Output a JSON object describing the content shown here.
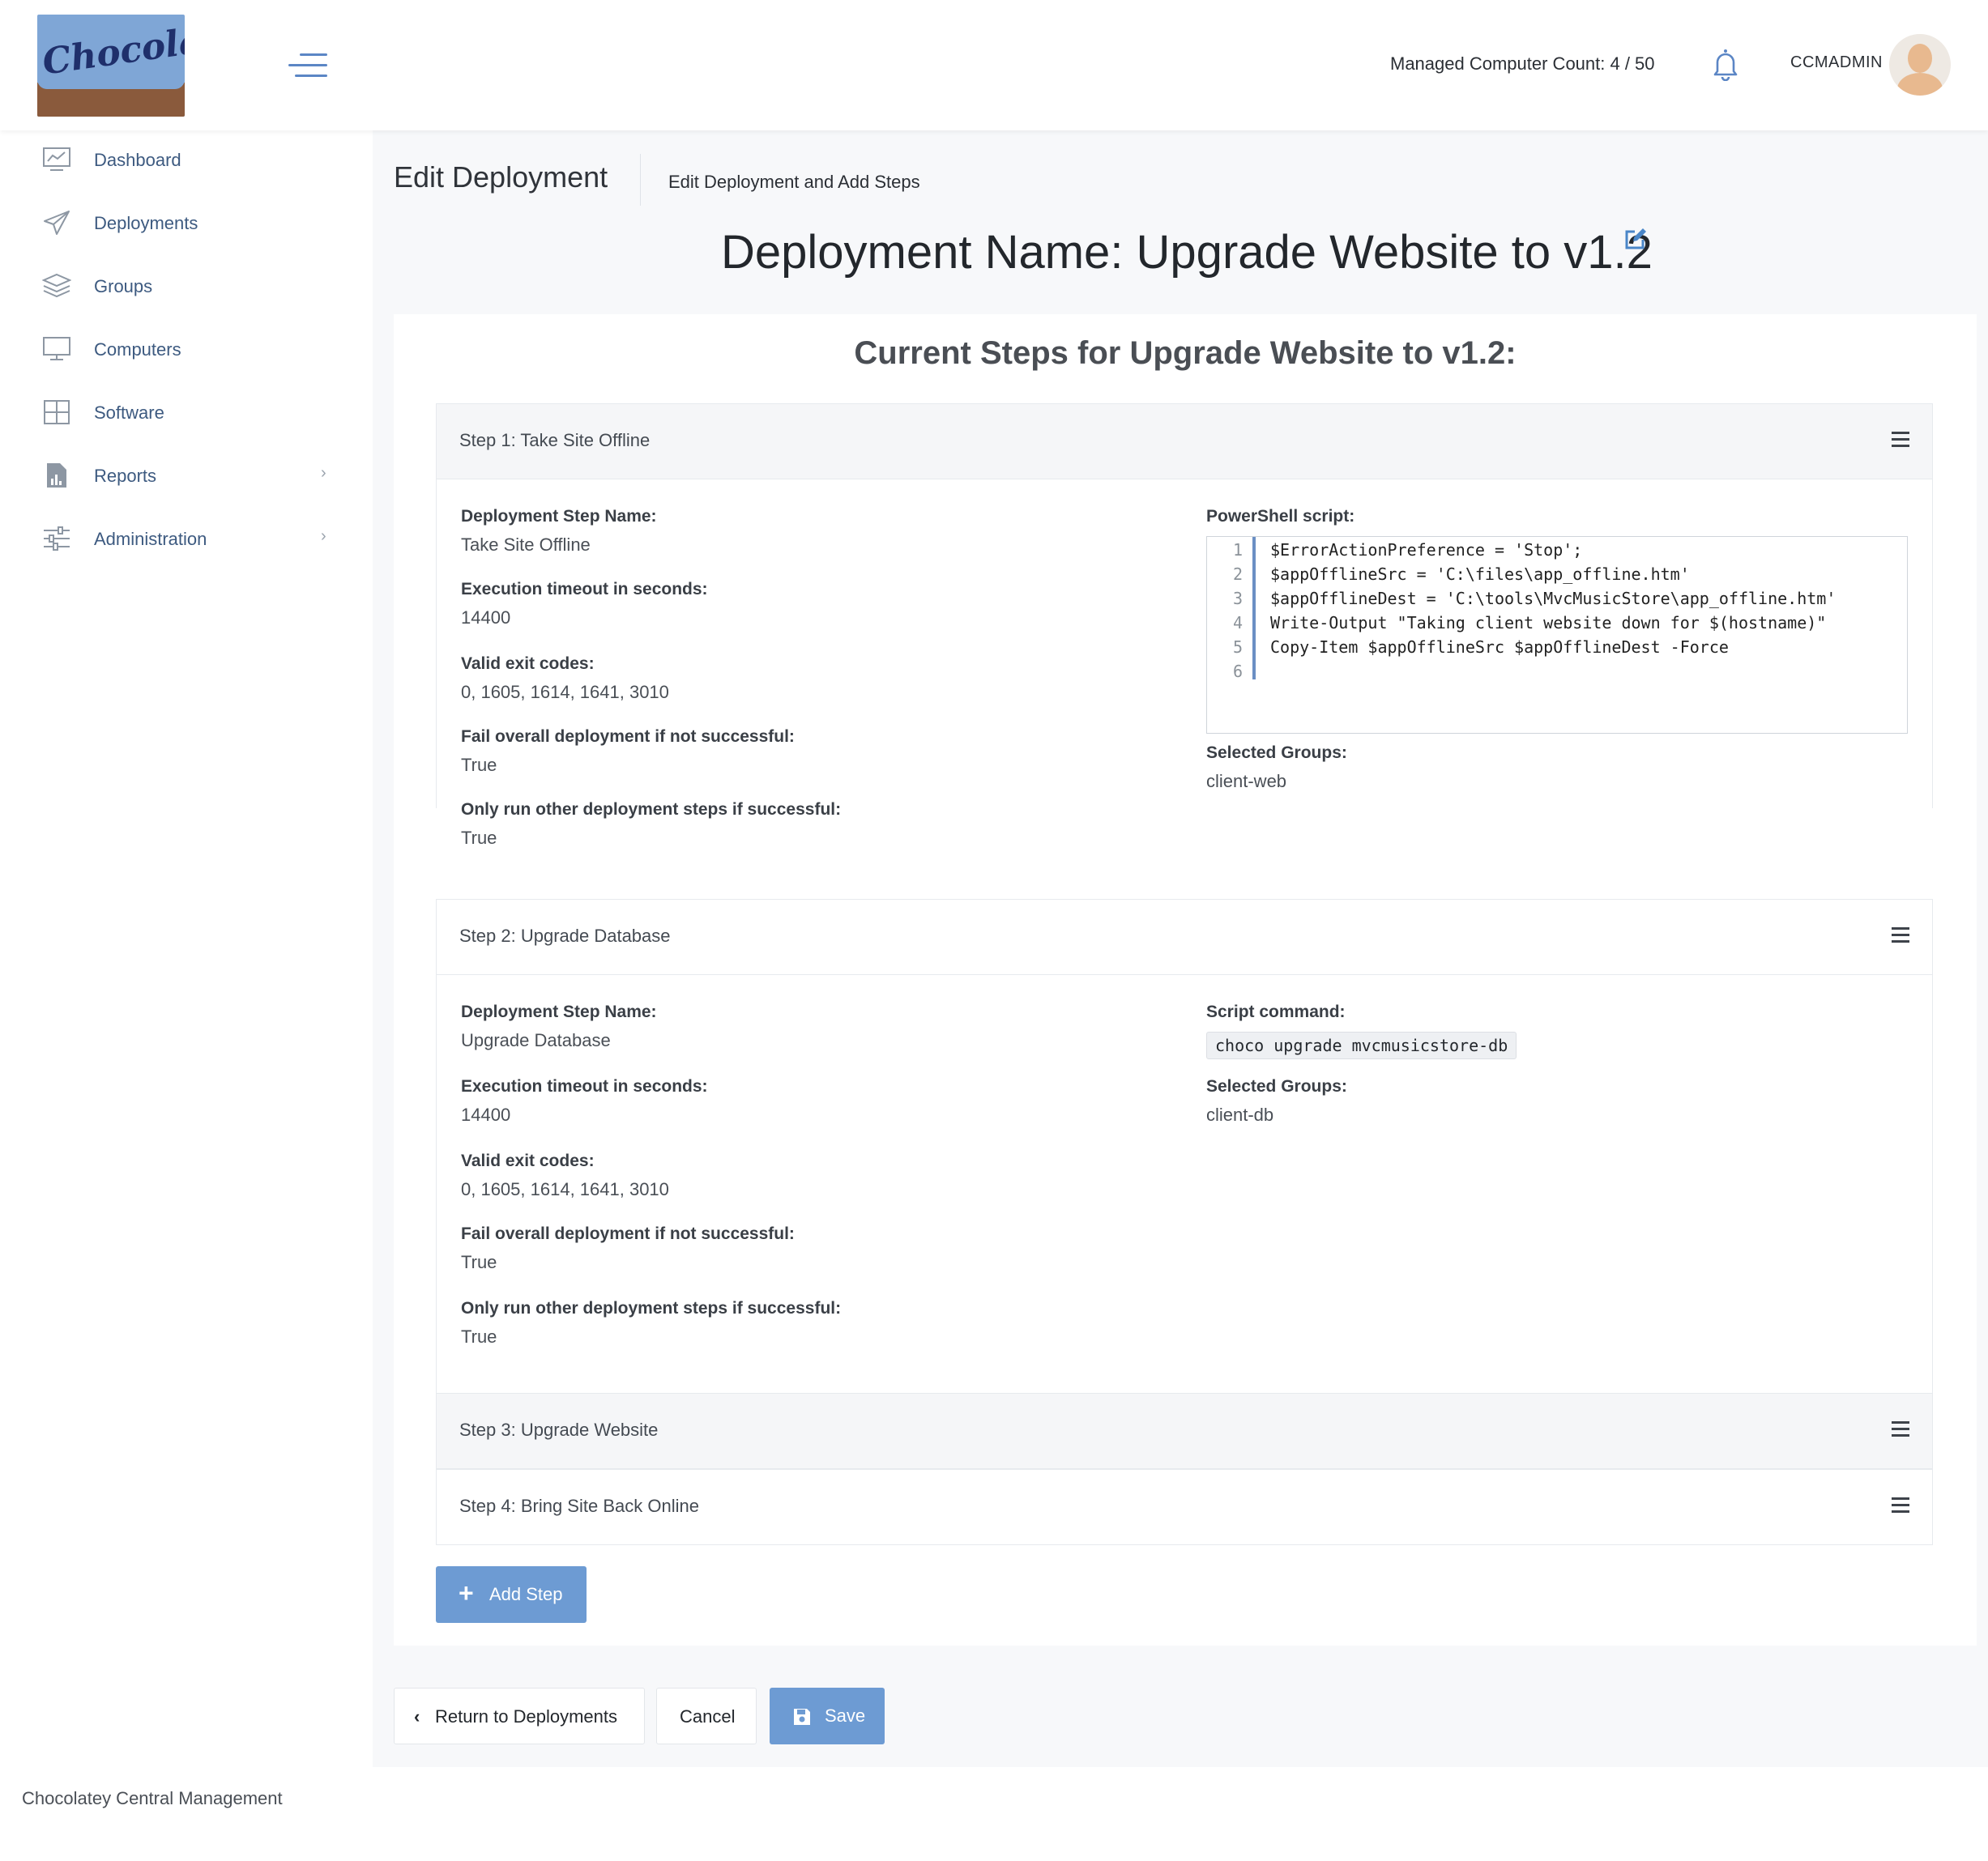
{
  "header": {
    "logo_text": "Chocolatey",
    "managed_count": "Managed Computer Count: 4 / 50",
    "username": "CCMADMIN"
  },
  "sidebar": {
    "items": [
      {
        "label": "Dashboard",
        "icon": "dashboard-icon"
      },
      {
        "label": "Deployments",
        "icon": "paper-plane-icon"
      },
      {
        "label": "Groups",
        "icon": "layers-icon"
      },
      {
        "label": "Computers",
        "icon": "monitor-icon"
      },
      {
        "label": "Software",
        "icon": "grid-icon"
      },
      {
        "label": "Reports",
        "icon": "report-icon",
        "chevron": "›"
      },
      {
        "label": "Administration",
        "icon": "sliders-icon",
        "chevron": "›"
      }
    ]
  },
  "page": {
    "title": "Edit Deployment",
    "subtitle": "Edit Deployment and Add Steps",
    "deployment_name": "Deployment Name: Upgrade Website to v1.2",
    "steps_title": "Current Steps for Upgrade Website to v1.2:"
  },
  "steps": [
    {
      "header": "Step 1: Take Site Offline",
      "labels": {
        "name": "Deployment Step Name:",
        "timeout": "Execution timeout in seconds:",
        "exit_codes": "Valid exit codes:",
        "fail_overall": "Fail overall deployment if not successful:",
        "only_run": "Only run other deployment steps if successful:",
        "script": "PowerShell script:",
        "groups": "Selected Groups:"
      },
      "name": "Take Site Offline",
      "timeout": "14400",
      "exit_codes": "0, 1605, 1614, 1641, 3010",
      "fail_overall": "True",
      "only_run": "True",
      "script_lines": [
        "$ErrorActionPreference = 'Stop';",
        "$appOfflineSrc = 'C:\\files\\app_offline.htm'",
        "$appOfflineDest = 'C:\\tools\\MvcMusicStore\\app_offline.htm'",
        "Write-Output \"Taking client website down for $(hostname)\"",
        "Copy-Item $appOfflineSrc $appOfflineDest -Force",
        ""
      ],
      "line_numbers": [
        "1",
        "2",
        "3",
        "4",
        "5",
        "6"
      ],
      "groups": "client-web"
    },
    {
      "header": "Step 2: Upgrade Database",
      "labels": {
        "name": "Deployment Step Name:",
        "timeout": "Execution timeout in seconds:",
        "exit_codes": "Valid exit codes:",
        "fail_overall": "Fail overall deployment if not successful:",
        "only_run": "Only run other deployment steps if successful:",
        "script": "Script command:",
        "groups": "Selected Groups:"
      },
      "name": "Upgrade Database",
      "timeout": "14400",
      "exit_codes": "0, 1605, 1614, 1641, 3010",
      "fail_overall": "True",
      "only_run": "True",
      "command": "choco upgrade mvcmusicstore-db",
      "groups": "client-db"
    },
    {
      "header": "Step 3: Upgrade Website"
    },
    {
      "header": "Step 4: Bring Site Back Online"
    }
  ],
  "buttons": {
    "add_step": "Add Step",
    "return": "Return to Deployments",
    "cancel": "Cancel",
    "save": "Save"
  },
  "footer": {
    "text": "Chocolatey Central Management"
  },
  "colors": {
    "accent": "#6d9bd3",
    "nav_text": "#3d5a80"
  }
}
